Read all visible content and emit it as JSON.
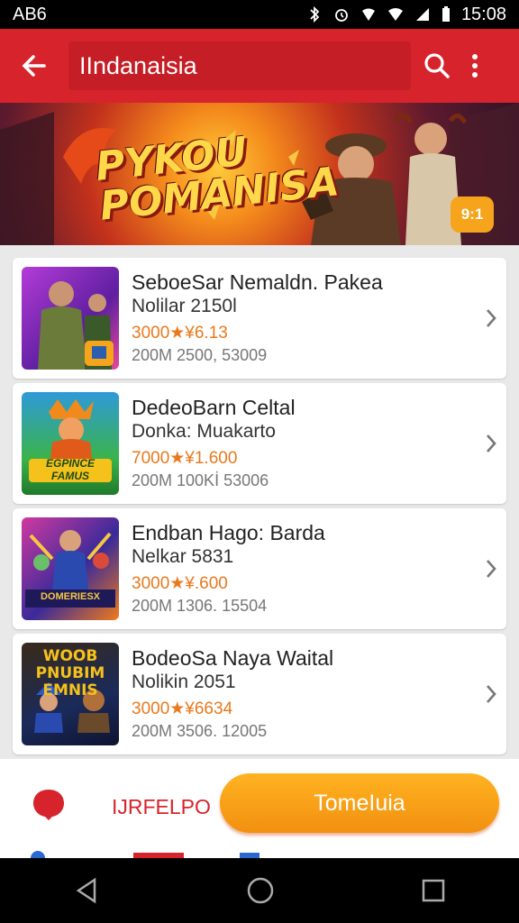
{
  "status_bar": {
    "carrier": "AB6",
    "time": "15:08"
  },
  "app_bar": {
    "title": "IIndanaisia"
  },
  "banner": {
    "title_line1": "PYKOU",
    "title_line2": "POMANISA",
    "badge": "9:1"
  },
  "games": [
    {
      "title": "SeboeSar Nemaldn. Pakea",
      "subtitle": "Nolilar 2150l",
      "price": "3000★¥6.13",
      "stats": "200M  2500, 53009"
    },
    {
      "title": "DedeoBarn Celtal",
      "subtitle": "Donka: Muakarto",
      "price": "7000★¥1.600",
      "stats": "200M  100Kİ 53006"
    },
    {
      "title": "Endban Hago: Barda",
      "subtitle": "Nelkar 5831",
      "price": "3000★¥.600",
      "stats": "200M  1306. 15504"
    },
    {
      "title": "BodeoSa Naya Waital",
      "subtitle": "Nolikin 2051",
      "price": "3000★¥6634",
      "stats": "200M  3506. 12005"
    }
  ],
  "thumbnails": [
    {
      "caption": ""
    },
    {
      "caption": "EGPINCE FAMUS"
    },
    {
      "caption": "DOMERIESX"
    },
    {
      "caption": "WOOB PNUBIM EMNIS"
    }
  ],
  "bottom_bar": {
    "help_label": "IJRFELPO",
    "cta_label": "TomeIuia"
  },
  "colors": {
    "primary": "#d7242c",
    "accent": "#f29010"
  }
}
